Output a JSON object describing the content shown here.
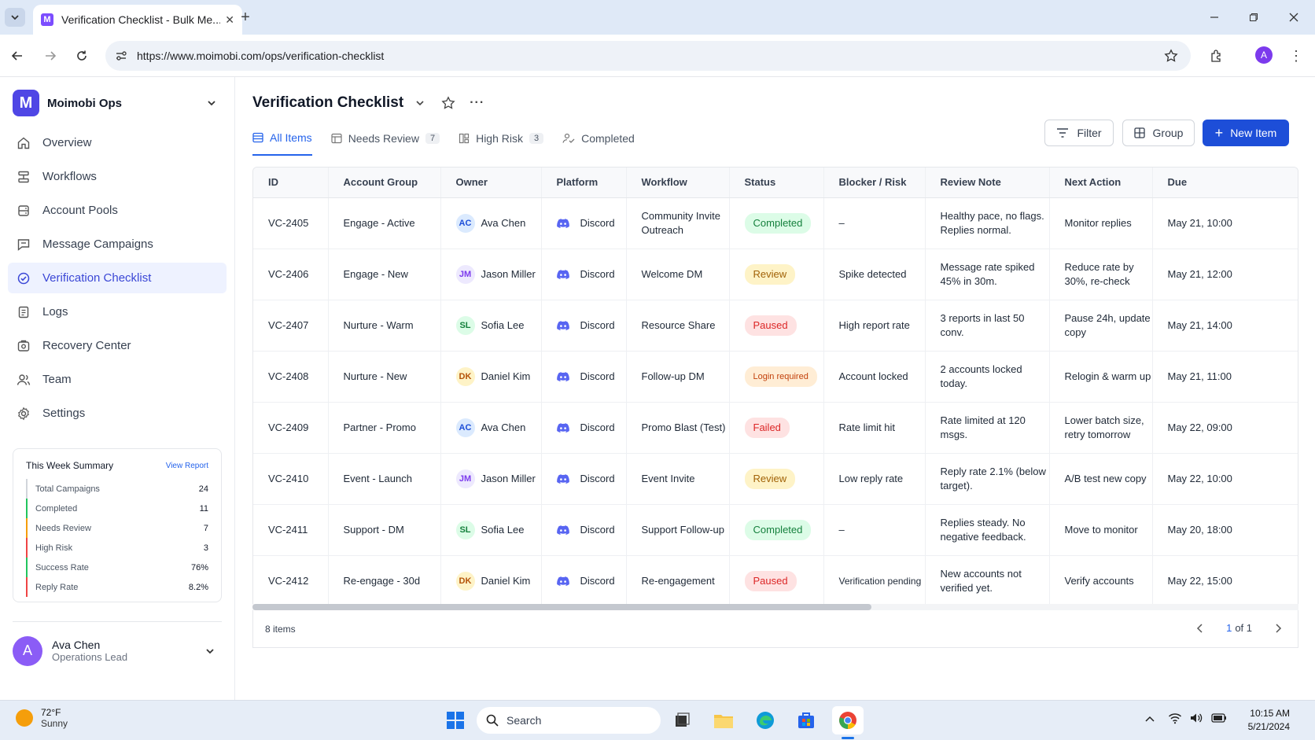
{
  "browser": {
    "tab_title": "Verification Checklist - Bulk Me...",
    "url": "https://www.moimobi.com/ops/verification-checklist",
    "profile_initial": "A"
  },
  "sidebar": {
    "workspace": {
      "logo": "M",
      "name": "Moimobi Ops"
    },
    "nav": [
      {
        "label": "Overview",
        "icon": "home-icon"
      },
      {
        "label": "Workflows",
        "icon": "workflow-icon"
      },
      {
        "label": "Account Pools",
        "icon": "database-icon"
      },
      {
        "label": "Message Campaigns",
        "icon": "message-icon"
      },
      {
        "label": "Verification Checklist",
        "icon": "check-circle-icon",
        "active": true
      },
      {
        "label": "Logs",
        "icon": "log-icon"
      },
      {
        "label": "Recovery Center",
        "icon": "lifebuoy-icon"
      },
      {
        "label": "Team",
        "icon": "team-icon"
      },
      {
        "label": "Settings",
        "icon": "gear-icon"
      }
    ],
    "summary": {
      "title": "This Week Summary",
      "link": "View Report",
      "rows": [
        {
          "label": "Total Campaigns",
          "value": "24",
          "color": "#d1d5db"
        },
        {
          "label": "Completed",
          "value": "11",
          "color": "#22c55e"
        },
        {
          "label": "Needs Review",
          "value": "7",
          "color": "#f59e0b"
        },
        {
          "label": "High Risk",
          "value": "3",
          "color": "#ef4444"
        },
        {
          "label": "Success Rate",
          "value": "76%",
          "color": "#22c55e"
        },
        {
          "label": "Reply Rate",
          "value": "8.2%",
          "color": "#ef4444"
        }
      ]
    },
    "user": {
      "initial": "A",
      "name": "Ava Chen",
      "role": "Operations Lead"
    }
  },
  "main": {
    "title": "Verification Checklist",
    "tabs": [
      {
        "label": "All Items",
        "badge": "",
        "active": true
      },
      {
        "label": "Needs Review",
        "badge": "7"
      },
      {
        "label": "High Risk",
        "badge": "3"
      },
      {
        "label": "Completed",
        "badge": ""
      }
    ],
    "buttons": {
      "filter": "Filter",
      "group": "Group",
      "new_item": "New Item"
    },
    "columns": [
      "ID",
      "Account Group",
      "Owner",
      "Platform",
      "Workflow",
      "Status",
      "Blocker / Risk",
      "Review Note",
      "Next Action",
      "Due"
    ],
    "rows": [
      {
        "id": "VC-2405",
        "group": "Engage - Active",
        "owner": "Ava Chen",
        "initials": "AC",
        "platform": "Discord",
        "workflow": "Community Invite Outreach",
        "status": "Completed",
        "status_type": "completed",
        "blocker": "–",
        "note": "Healthy pace, no flags. Replies normal.",
        "action": "Monitor replies",
        "due": "May 21, 10:00"
      },
      {
        "id": "VC-2406",
        "group": "Engage - New",
        "owner": "Jason Miller",
        "initials": "JM",
        "platform": "Discord",
        "workflow": "Welcome DM",
        "status": "Review",
        "status_type": "review",
        "blocker": "Spike detected",
        "note": "Message rate spiked 45% in 30m.",
        "action": "Reduce rate by 30%, re-check",
        "due": "May 21, 12:00"
      },
      {
        "id": "VC-2407",
        "group": "Nurture - Warm",
        "owner": "Sofia Lee",
        "initials": "SL",
        "platform": "Discord",
        "workflow": "Resource Share",
        "status": "Paused",
        "status_type": "paused",
        "blocker": "High report rate",
        "note": "3 reports in last 50 conv.",
        "action": "Pause 24h, update copy",
        "due": "May 21, 14:00"
      },
      {
        "id": "VC-2408",
        "group": "Nurture - New",
        "owner": "Daniel Kim",
        "initials": "DK",
        "platform": "Discord",
        "workflow": "Follow-up DM",
        "status": "Login required",
        "status_type": "login",
        "blocker": "Account locked",
        "note": "2 accounts locked today.",
        "action": "Relogin & warm up",
        "due": "May 21, 11:00"
      },
      {
        "id": "VC-2409",
        "group": "Partner - Promo",
        "owner": "Ava Chen",
        "initials": "AC",
        "platform": "Discord",
        "workflow": "Promo Blast (Test)",
        "status": "Failed",
        "status_type": "failed",
        "blocker": "Rate limit hit",
        "note": "Rate limited at 120 msgs.",
        "action": "Lower batch size, retry tomorrow",
        "due": "May 22, 09:00"
      },
      {
        "id": "VC-2410",
        "group": "Event - Launch",
        "owner": "Jason Miller",
        "initials": "JM",
        "platform": "Discord",
        "workflow": "Event Invite",
        "status": "Review",
        "status_type": "review",
        "blocker": "Low reply rate",
        "note": "Reply rate 2.1% (below target).",
        "action": "A/B test new copy",
        "due": "May 22, 10:00"
      },
      {
        "id": "VC-2411",
        "group": "Support - DM",
        "owner": "Sofia Lee",
        "initials": "SL",
        "platform": "Discord",
        "workflow": "Support Follow-up",
        "status": "Completed",
        "status_type": "completed",
        "blocker": "–",
        "note": "Replies steady. No negative feedback.",
        "action": "Move to monitor",
        "due": "May 20, 18:00"
      },
      {
        "id": "VC-2412",
        "group": "Re-engage - 30d",
        "owner": "Daniel Kim",
        "initials": "DK",
        "platform": "Discord",
        "workflow": "Re-engagement",
        "status": "Paused",
        "status_type": "paused",
        "blocker": "Verification pending",
        "note": "New accounts not verified yet.",
        "action": "Verify accounts",
        "due": "May 22, 15:00"
      }
    ],
    "footer": {
      "count": "8 items",
      "page_current": "1",
      "page_of": "of 1"
    }
  },
  "taskbar": {
    "weather_temp": "72°F",
    "weather_desc": "Sunny",
    "search_placeholder": "Search",
    "time": "10:15 AM",
    "date": "5/21/2024"
  },
  "colors": {
    "accent": "#1d4ed8",
    "nav_active_bg": "#eef2ff",
    "discord": "#5865f2"
  }
}
